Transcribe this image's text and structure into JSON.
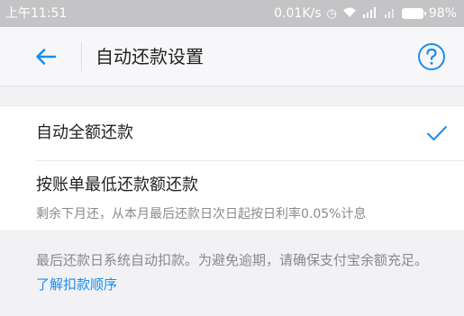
{
  "statusbar": {
    "time": "上午11:51",
    "speed": "0.01K/s",
    "battery": "98%"
  },
  "header": {
    "title": "自动还款设置",
    "back_icon": "arrow-left-icon",
    "help_icon": "question-circle-icon"
  },
  "options": [
    {
      "label": "自动全额还款",
      "selected": true
    },
    {
      "label": "按账单最低还款额还款",
      "sub": "剩余下月还，从本月最后还款日次日起按日利率0.05%计息",
      "selected": false
    }
  ],
  "note": {
    "text": "最后还款日系统自动扣款。为避免逾期，请确保支付宝余额充足。",
    "link": "了解扣款顺序"
  },
  "colors": {
    "accent": "#1a8df0",
    "statusbar": "#c4c4c6",
    "background": "#f2f2f4"
  }
}
